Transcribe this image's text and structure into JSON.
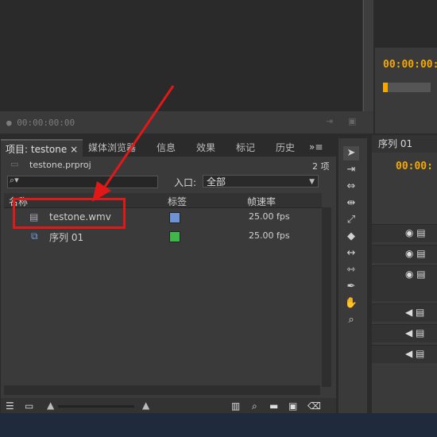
{
  "source_monitor": {
    "timecode": "00:00:00:00"
  },
  "program_monitor": {
    "timecode": "00:00:00:"
  },
  "project_panel": {
    "tabs": [
      {
        "label": "项目: testone",
        "close": "×"
      },
      {
        "label": "媒体浏览器"
      },
      {
        "label": "信息"
      },
      {
        "label": "效果"
      },
      {
        "label": "标记"
      },
      {
        "label": "历史"
      }
    ],
    "project_file": "testone.prproj",
    "item_count": "2 项",
    "in_label": "入口:",
    "in_value": "全部",
    "columns": [
      "名称",
      "标签",
      "帧速率"
    ],
    "items": [
      {
        "name": "testone.wmv",
        "label_color": "#6f93d2",
        "fps": "25.00 fps"
      },
      {
        "name": "序列 01",
        "label_color": "#3fb54a",
        "fps": "25.00 fps"
      }
    ]
  },
  "sequence_panel": {
    "tab": "序列 01",
    "timecode": "00:00:"
  },
  "colors": {
    "timecode": "#f5a800",
    "highlight": "#e01818"
  },
  "icons": [
    "selection-tool-icon",
    "track-select-icon",
    "ripple-edit-icon",
    "rolling-edit-icon",
    "rate-stretch-icon",
    "razor-icon",
    "slip-icon",
    "slide-icon",
    "pen-icon",
    "hand-icon",
    "zoom-icon"
  ]
}
